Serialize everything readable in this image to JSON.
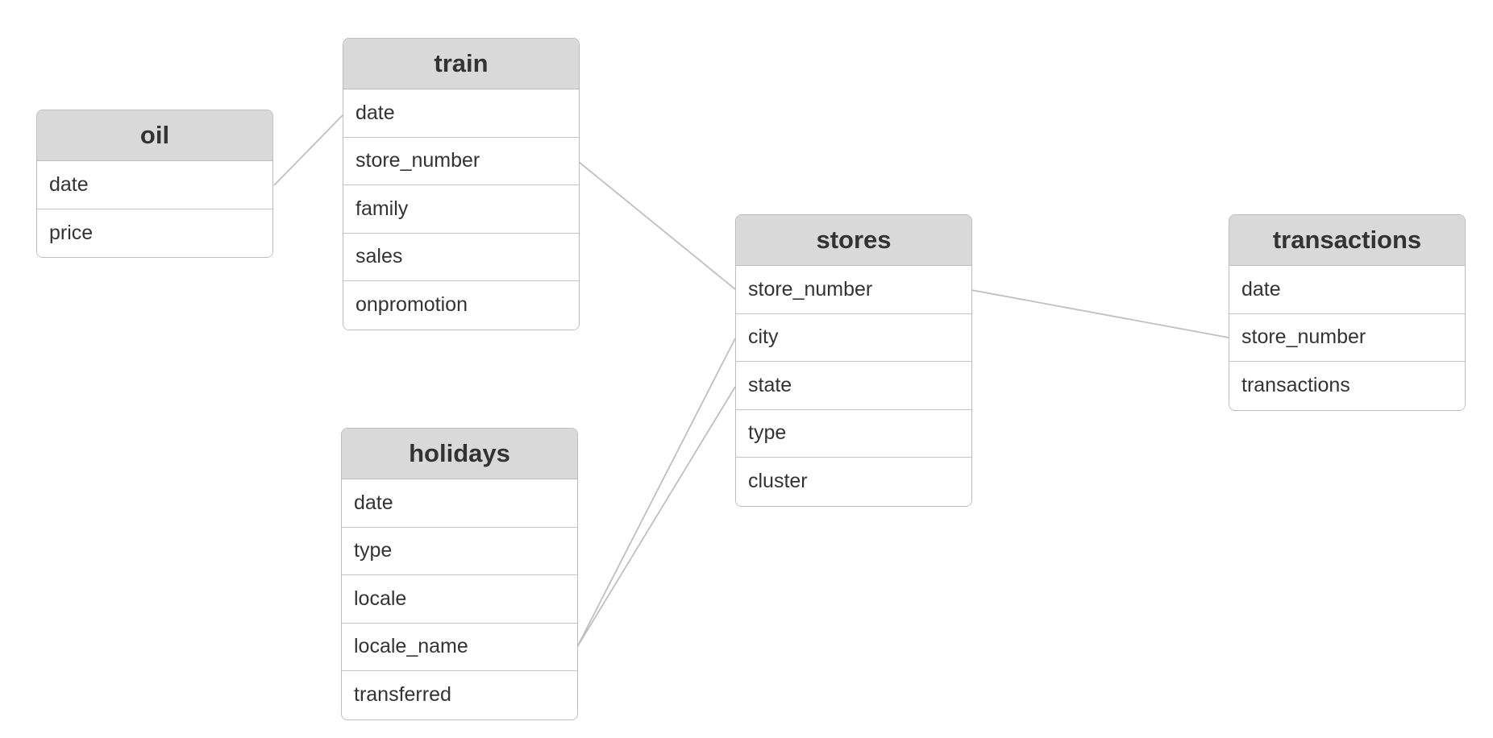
{
  "tables": {
    "oil": {
      "title": "oil",
      "columns": [
        "date",
        "price"
      ]
    },
    "train": {
      "title": "train",
      "columns": [
        "date",
        "store_number",
        "family",
        "sales",
        "onpromotion"
      ]
    },
    "holidays": {
      "title": "holidays",
      "columns": [
        "date",
        "type",
        "locale",
        "locale_name",
        "transferred"
      ]
    },
    "stores": {
      "title": "stores",
      "columns": [
        "store_number",
        "city",
        "state",
        "type",
        "cluster"
      ]
    },
    "transactions": {
      "title": "transactions",
      "columns": [
        "date",
        "store_number",
        "transactions"
      ]
    }
  },
  "relationships": [
    {
      "from": "oil.date",
      "to": "train.date"
    },
    {
      "from": "train.store_number",
      "to": "stores.store_number"
    },
    {
      "from": "stores.store_number",
      "to": "transactions.store_number"
    },
    {
      "from": "holidays.locale_name",
      "to": "stores.city"
    },
    {
      "from": "holidays.locale_name",
      "to": "stores.state"
    }
  ],
  "colors": {
    "header_bg": "#d9d9d9",
    "border": "#bdbdbd",
    "connector": "#bfbfbf",
    "text": "#333333"
  }
}
